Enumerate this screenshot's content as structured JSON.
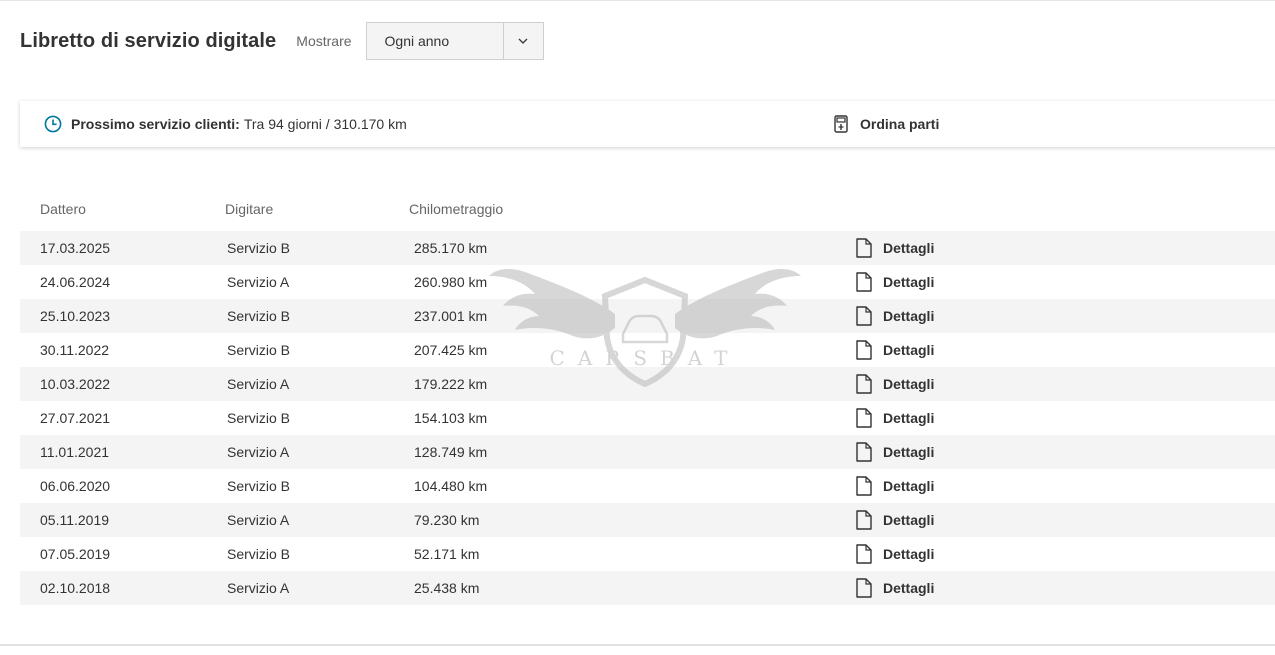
{
  "header": {
    "title": "Libretto di servizio digitale",
    "show_label": "Mostrare",
    "filter_value": "Ogni anno"
  },
  "service_card": {
    "next_label": "Prossimo servizio clienti:",
    "next_value": "Tra 94 giorni / 310.170 km",
    "order_parts": "Ordina parti"
  },
  "table": {
    "columns": [
      "Dattero",
      "Digitare",
      "Chilometraggio"
    ],
    "details_label": "Dettagli",
    "rows": [
      {
        "date": "17.03.2025",
        "type": "Servizio B",
        "km": "285.170 km"
      },
      {
        "date": "24.06.2024",
        "type": "Servizio A",
        "km": "260.980 km"
      },
      {
        "date": "25.10.2023",
        "type": "Servizio B",
        "km": "237.001 km"
      },
      {
        "date": "30.11.2022",
        "type": "Servizio B",
        "km": "207.425 km"
      },
      {
        "date": "10.03.2022",
        "type": "Servizio A",
        "km": "179.222 km"
      },
      {
        "date": "27.07.2021",
        "type": "Servizio B",
        "km": "154.103 km"
      },
      {
        "date": "11.01.2021",
        "type": "Servizio A",
        "km": "128.749 km"
      },
      {
        "date": "06.06.2020",
        "type": "Servizio B",
        "km": "104.480 km"
      },
      {
        "date": "05.11.2019",
        "type": "Servizio A",
        "km": "79.230 km"
      },
      {
        "date": "07.05.2019",
        "type": "Servizio B",
        "km": "52.171 km"
      },
      {
        "date": "02.10.2018",
        "type": "Servizio A",
        "km": "25.438 km"
      }
    ]
  },
  "watermark": {
    "text": "CARSBAT"
  },
  "icons": {
    "clock": "clock-icon",
    "parts": "parts-icon",
    "document": "document-icon",
    "dropdown": "chevron-down-icon"
  },
  "colors": {
    "accent": "#0078a0",
    "text": "#333333",
    "muted": "#666666",
    "row_alt": "#f4f4f4"
  }
}
